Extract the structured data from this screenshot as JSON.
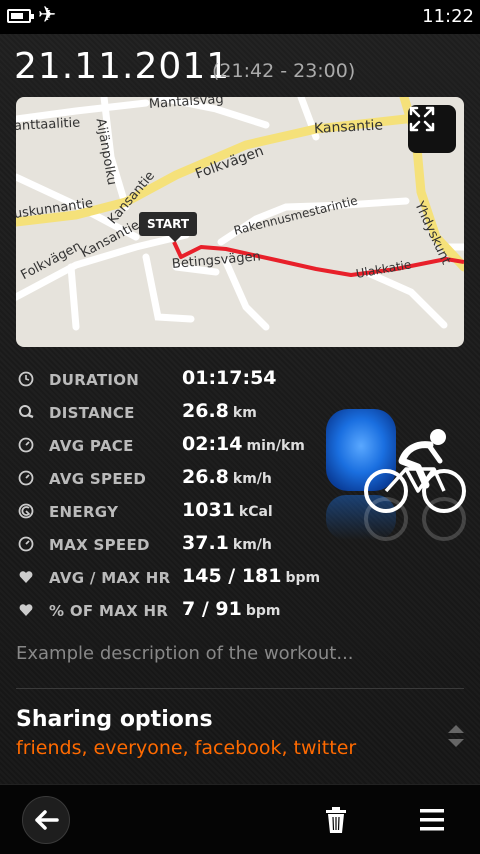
{
  "status_bar": {
    "time": "11:22"
  },
  "header": {
    "date": "21.11.2011",
    "time_range": "(21:42 - 23:00)"
  },
  "map": {
    "start_label": "START",
    "street_names": [
      "Mantalsväg",
      "Aijänpolku",
      "Kansantie",
      "anttaalitie",
      "uskunnantie",
      "Kansantie",
      "Folkvägen",
      "Folkvägen",
      "Kansantie",
      "Rakennusmestarintie",
      "Betingsvägen",
      "Ulakkatie",
      "Yhdyskunt"
    ]
  },
  "stats": [
    {
      "icon": "clock-icon",
      "label": "DURATION",
      "value": "01:17:54",
      "unit": ""
    },
    {
      "icon": "distance-icon",
      "label": "DISTANCE",
      "value": "26.8",
      "unit": "km"
    },
    {
      "icon": "gauge-icon",
      "label": "AVG PACE",
      "value": "02:14",
      "unit": "min/km"
    },
    {
      "icon": "gauge-icon",
      "label": "AVG SPEED",
      "value": "26.8",
      "unit": "km/h"
    },
    {
      "icon": "energy-icon",
      "label": "ENERGY",
      "value": "1031",
      "unit": "kCal"
    },
    {
      "icon": "gauge-icon",
      "label": "MAX SPEED",
      "value": "37.1",
      "unit": "km/h"
    },
    {
      "icon": "heart-icon",
      "label": "AVG / MAX HR",
      "value": "145 / 181",
      "unit": "bpm"
    },
    {
      "icon": "heart-icon",
      "label": "% OF MAX HR",
      "value": "7 / 91",
      "unit": "bpm"
    }
  ],
  "description": "Example description of the workout...",
  "sharing": {
    "title": "Sharing options",
    "value": "friends, everyone, facebook, twitter"
  },
  "colors": {
    "accent": "#ff6a00",
    "route": "#e8202a",
    "sport_blue": "#1a6fe0"
  }
}
